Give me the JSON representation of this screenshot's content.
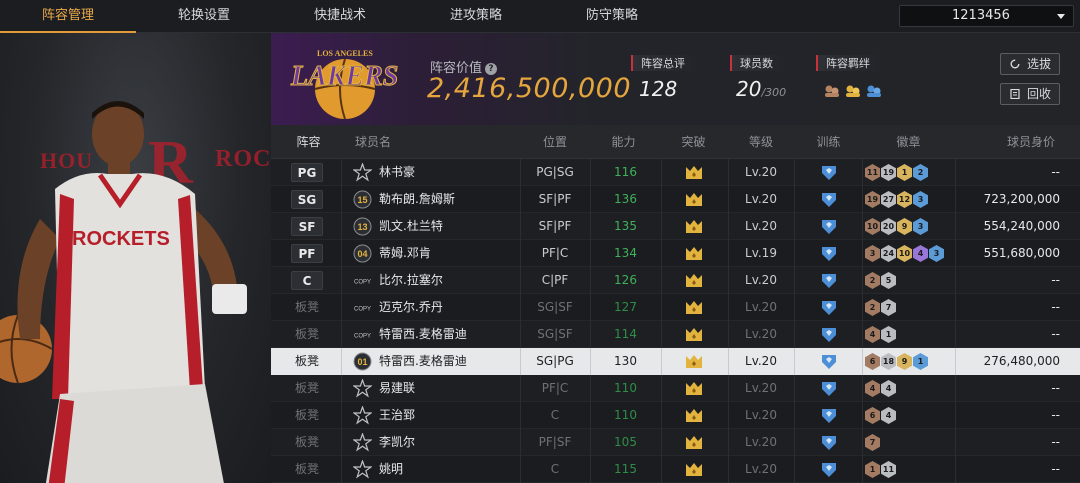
{
  "tabs": [
    {
      "label": "阵容管理",
      "active": true
    },
    {
      "label": "轮换设置",
      "active": false
    },
    {
      "label": "快捷战术",
      "active": false
    },
    {
      "label": "进攻策略",
      "active": false
    },
    {
      "label": "防守策略",
      "active": false
    }
  ],
  "account_id": "1213456",
  "team": {
    "logo_name": "lakers-logo",
    "logo_text_small": "LOS ANGELES",
    "logo_text": "LAKERS",
    "value_label": "阵容价值",
    "value": "2,416,500,000"
  },
  "stats": {
    "overall_label": "阵容总评",
    "overall_value": "128",
    "count_label": "球员数",
    "count_value": "20",
    "count_max": "/300",
    "chem_label": "阵容羁绊"
  },
  "buttons": {
    "select": "选拔",
    "recycle": "回收"
  },
  "columns": [
    "阵容",
    "球员名",
    "位置",
    "能力",
    "突破",
    "等级",
    "训练",
    "徽章",
    "球员身价"
  ],
  "players": [
    {
      "slot": "PG",
      "bench": false,
      "jersey": "",
      "name": "林书豪",
      "position": "PG|SG",
      "ability": "116",
      "level": "Lv.20",
      "badges": [
        {
          "v": "11",
          "c": "br"
        },
        {
          "v": "19",
          "c": "si"
        },
        {
          "v": "1",
          "c": "go"
        },
        {
          "v": "2",
          "c": "bl"
        }
      ],
      "price": "--"
    },
    {
      "slot": "SG",
      "bench": false,
      "jersey": "15",
      "name": "勒布朗.詹姆斯",
      "position": "SF|PF",
      "ability": "136",
      "level": "Lv.20",
      "badges": [
        {
          "v": "19",
          "c": "br"
        },
        {
          "v": "27",
          "c": "si"
        },
        {
          "v": "12",
          "c": "go"
        },
        {
          "v": "3",
          "c": "bl"
        }
      ],
      "price": "723,200,000"
    },
    {
      "slot": "SF",
      "bench": false,
      "jersey": "13",
      "name": "凯文.杜兰特",
      "position": "SF|PF",
      "ability": "135",
      "level": "Lv.20",
      "badges": [
        {
          "v": "10",
          "c": "br"
        },
        {
          "v": "20",
          "c": "si"
        },
        {
          "v": "9",
          "c": "go"
        },
        {
          "v": "3",
          "c": "bl"
        }
      ],
      "price": "554,240,000"
    },
    {
      "slot": "PF",
      "bench": false,
      "jersey": "04",
      "name": "蒂姆.邓肯",
      "position": "PF|C",
      "ability": "134",
      "level": "Lv.19",
      "badges": [
        {
          "v": "3",
          "c": "br"
        },
        {
          "v": "24",
          "c": "si"
        },
        {
          "v": "10",
          "c": "go"
        },
        {
          "v": "4",
          "c": "pu"
        },
        {
          "v": "3",
          "c": "bl"
        }
      ],
      "price": "551,680,000"
    },
    {
      "slot": "C",
      "bench": false,
      "jersey": "COPY",
      "name": "比尔.拉塞尔",
      "position": "C|PF",
      "ability": "126",
      "level": "Lv.20",
      "badges": [
        {
          "v": "2",
          "c": "br"
        },
        {
          "v": "5",
          "c": "si"
        }
      ],
      "price": "--"
    },
    {
      "slot": "板凳",
      "bench": true,
      "jersey": "COPY",
      "name": "迈克尔.乔丹",
      "position": "SG|SF",
      "ability": "127",
      "level": "Lv.20",
      "badges": [
        {
          "v": "2",
          "c": "br"
        },
        {
          "v": "7",
          "c": "si"
        }
      ],
      "price": "--"
    },
    {
      "slot": "板凳",
      "bench": true,
      "jersey": "COPY",
      "name": "特雷西.麦格雷迪",
      "position": "SG|SF",
      "ability": "114",
      "level": "Lv.20",
      "badges": [
        {
          "v": "4",
          "c": "br"
        },
        {
          "v": "1",
          "c": "si"
        }
      ],
      "price": "--"
    },
    {
      "slot": "板凳",
      "bench": true,
      "selected": true,
      "jersey": "01",
      "name": "特雷西.麦格雷迪",
      "position": "SG|PG",
      "ability": "130",
      "level": "Lv.20",
      "badges": [
        {
          "v": "6",
          "c": "br"
        },
        {
          "v": "18",
          "c": "si"
        },
        {
          "v": "9",
          "c": "go"
        },
        {
          "v": "1",
          "c": "bl"
        }
      ],
      "price": "276,480,000"
    },
    {
      "slot": "板凳",
      "bench": true,
      "jersey": "",
      "name": "易建联",
      "position": "PF|C",
      "ability": "110",
      "level": "Lv.20",
      "badges": [
        {
          "v": "4",
          "c": "br"
        },
        {
          "v": "4",
          "c": "si"
        }
      ],
      "price": "--"
    },
    {
      "slot": "板凳",
      "bench": true,
      "jersey": "",
      "name": "王治郅",
      "position": "C",
      "ability": "110",
      "level": "Lv.20",
      "badges": [
        {
          "v": "6",
          "c": "br"
        },
        {
          "v": "4",
          "c": "si"
        }
      ],
      "price": "--"
    },
    {
      "slot": "板凳",
      "bench": true,
      "jersey": "",
      "name": "李凯尔",
      "position": "PF|SF",
      "ability": "105",
      "level": "Lv.20",
      "badges": [
        {
          "v": "7",
          "c": "br"
        }
      ],
      "price": "--"
    },
    {
      "slot": "板凳",
      "bench": true,
      "jersey": "",
      "name": "姚明",
      "position": "C",
      "ability": "115",
      "level": "Lv.20",
      "badges": [
        {
          "v": "1",
          "c": "br"
        },
        {
          "v": "11",
          "c": "si"
        }
      ],
      "price": "--"
    }
  ],
  "left_panel": {
    "team_text_left": "HOU",
    "team_letter": "R",
    "team_text_right": "ROCK",
    "jersey_text": "ROCKETS"
  }
}
